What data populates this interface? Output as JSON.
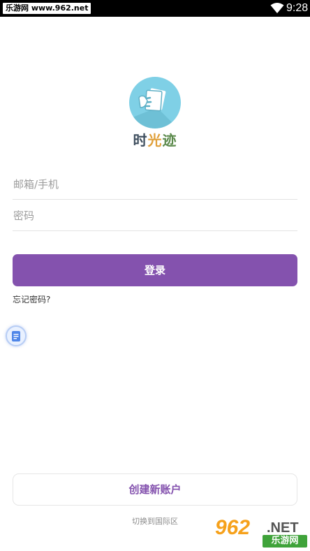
{
  "status_bar": {
    "watermark_text": "乐游网 www.962.net",
    "time": "9:28",
    "wifi_icon": "wifi-icon"
  },
  "brand": {
    "logo_icon": "hand-holding-paper-icon",
    "name_char_1": "时",
    "name_char_2": "光",
    "name_char_3": "迹"
  },
  "login_form": {
    "email_placeholder": "邮箱/手机",
    "password_placeholder": "密码",
    "email_value": "",
    "password_value": "",
    "login_label": "登录",
    "forgot_label": "忘记密码?"
  },
  "floating_button": {
    "icon": "document-icon"
  },
  "footer": {
    "create_account_label": "创建新账户",
    "region_switch_label": "切换到国际区"
  },
  "watermark": {
    "number": "962",
    "suffix": ".NET",
    "site_name": "乐游网"
  },
  "colors": {
    "accent": "#8452ae",
    "logo_bg": "#7fd0e6",
    "status_bar": "#000000",
    "watermark_orange": "#f6a11b",
    "watermark_green": "#3fa33a"
  }
}
